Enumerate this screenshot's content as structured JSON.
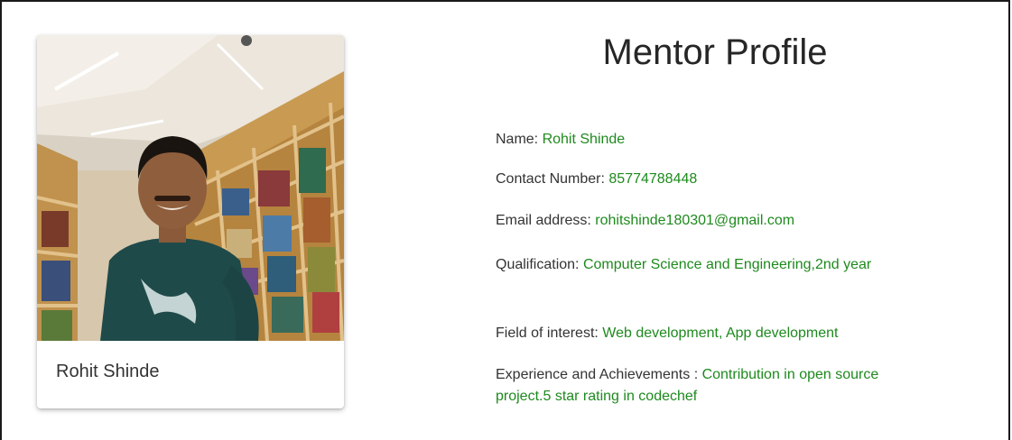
{
  "page": {
    "title": "Mentor Profile"
  },
  "card": {
    "name": "Rohit Shinde",
    "photo_icon": "profile-photo"
  },
  "details": [
    {
      "label": "Name: ",
      "value": "Rohit Shinde"
    },
    {
      "label": "Contact Number: ",
      "value": "85774788448"
    },
    {
      "label": "Email address: ",
      "value": "rohitshinde180301@gmail.com"
    },
    {
      "label": "Qualification: ",
      "value": "Computer Science and Engineering,2nd year"
    },
    {
      "label": "Field of interest: ",
      "value": "Web development, App development"
    },
    {
      "label": "Experience and Achievements : ",
      "value": "Contribution in open source project.5 star rating in codechef"
    }
  ],
  "colors": {
    "value_text": "#1e8a1e",
    "label_text": "#333333",
    "title_text": "#262626"
  }
}
